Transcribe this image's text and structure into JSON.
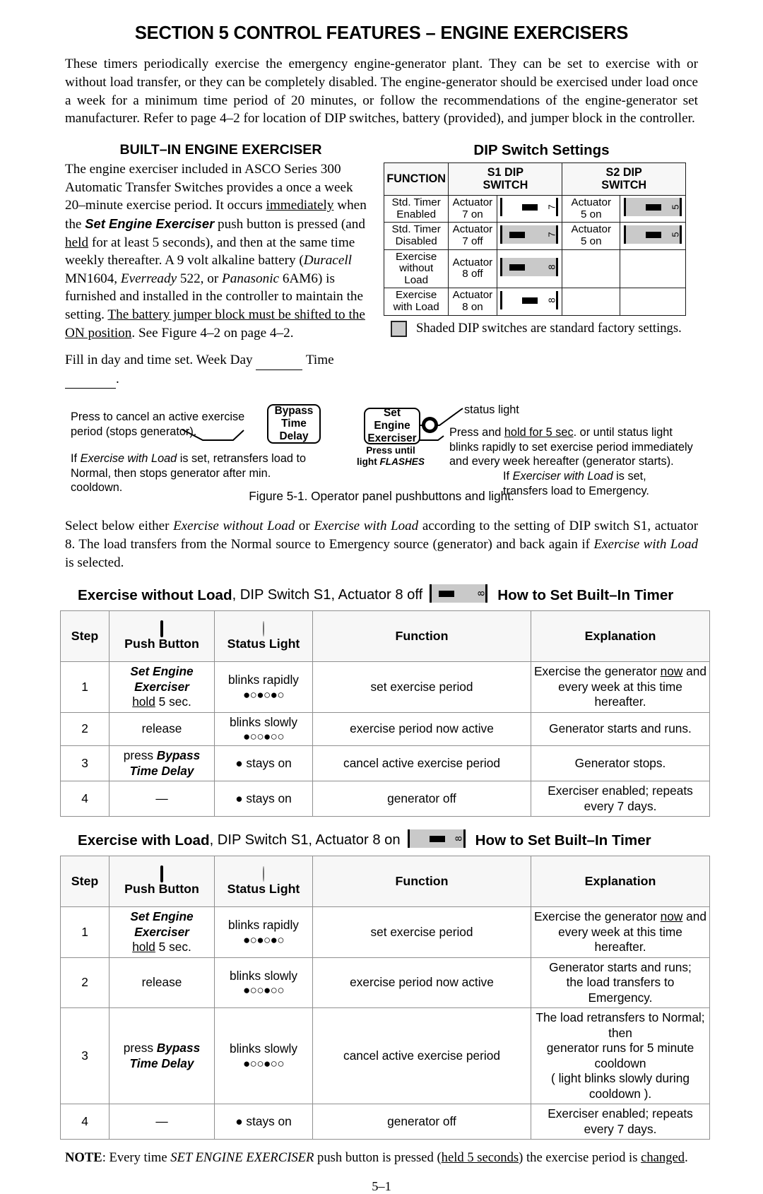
{
  "document": {
    "section_title": "SECTION 5  CONTROL FEATURES – ENGINE EXERCISERS",
    "intro": "These timers periodically exercise the emergency engine-generator plant.  They can be set to exercise with or without load transfer, or they can be completely disabled.  The engine-generator should be exercised under load once a week for a minimum time period of 20 minutes, or follow the recommendations of the engine-generator set manufacturer.  Refer to page 4–2 for location of DIP switches, battery (provided), and jumper block in the controller.",
    "page_number": "5–1",
    "note_label": "NOTE",
    "note_text_1": ": Every time ",
    "note_italic": "SET ENGINE EXERCISER",
    "note_text_2": " push button is pressed (",
    "note_underline": "held 5 seconds",
    "note_text_3": ") the exercise period is ",
    "note_underline_2": "changed",
    "note_text_4": "."
  },
  "built_in": {
    "heading": "BUILT–IN ENGINE EXERCISER",
    "para_1_a": "The engine exerciser included in ASCO Series 300 Automatic Transfer Switches provides a once a week 20–minute exercise period.  It occurs ",
    "para_1_u1": "immediately",
    "para_1_b": " when the ",
    "para_1_bi": "Set Engine Exerciser",
    "para_1_c": " push button is pressed (and ",
    "para_1_u2": "held",
    "para_1_d": " for at least 5 seconds), and then at the same time weekly thereafter.  A 9 volt alkaline battery (",
    "para_1_i1": "Duracell",
    "para_1_e": " MN1604, ",
    "para_1_i2": "Everready",
    "para_1_f": " 522, or ",
    "para_1_i3": "Panasonic",
    "para_1_g": " 6AM6) is furnished and installed in the controller to maintain the setting.  ",
    "para_1_u3": "The battery jumper block must be shifted to the ON position",
    "para_1_h": ".  See Figure 4–2 on page 4–2.",
    "fill_in_a": "Fill in day and time set.  Week Day ",
    "fill_in_b": " Time ",
    "fill_in_c": "."
  },
  "dip_table": {
    "title": "DIP Switch Settings",
    "headers": [
      "FUNCTION",
      "S1 DIP\nSWITCH",
      "S2 DIP\nSWITCH"
    ],
    "header_function": "FUNCTION",
    "header_s1_line1": "S1 DIP",
    "header_s1_line2": "SWITCH",
    "header_s2_line1": "S2 DIP",
    "header_s2_line2": "SWITCH",
    "rows": [
      {
        "function_line1": "Std. Timer",
        "function_line2": "Enabled",
        "s1_actuator_line1": "Actuator",
        "s1_actuator_line2": "7 on",
        "s1_switch": {
          "number": "7",
          "position": "right",
          "shaded": false
        },
        "s2_actuator_line1": "Actuator",
        "s2_actuator_line2": "5 on",
        "s2_switch": {
          "number": "5",
          "position": "right",
          "shaded": true
        }
      },
      {
        "function_line1": "Std. Timer",
        "function_line2": "Disabled",
        "s1_actuator_line1": "Actuator",
        "s1_actuator_line2": "7 off",
        "s1_switch": {
          "number": "7",
          "position": "left",
          "shaded": true
        },
        "s2_actuator_line1": "Actuator",
        "s2_actuator_line2": "5 on",
        "s2_switch": {
          "number": "5",
          "position": "right",
          "shaded": true
        }
      },
      {
        "function_line1": "Exercise",
        "function_line2": "without",
        "function_line3": "Load",
        "s1_actuator_line1": "Actuator",
        "s1_actuator_line2": "8 off",
        "s1_switch": {
          "number": "8",
          "position": "left",
          "shaded": true
        },
        "s2_actuator_line1": "",
        "s2_actuator_line2": "",
        "s2_switch": null
      },
      {
        "function_line1": "Exercise",
        "function_line2": "with Load",
        "s1_actuator_line1": "Actuator",
        "s1_actuator_line2": "8 on",
        "s1_switch": {
          "number": "8",
          "position": "right",
          "shaded": false
        },
        "s2_actuator_line1": "",
        "s2_actuator_line2": "",
        "s2_switch": null
      }
    ],
    "shaded_note": "Shaded DIP switches are standard factory settings."
  },
  "figure": {
    "caption": "Figure 5-1. Operator panel pushbuttons and light.",
    "bypass_button_line1": "Bypass",
    "bypass_button_line2": "Time Delay",
    "bypass_callout_line1": "Press to cancel an active exercise",
    "bypass_callout_line2": "period (stops generator).",
    "bypass_note_a": "If ",
    "bypass_note_i": "Exercise with Load",
    "bypass_note_b": " is set, retransfers load to",
    "bypass_note_line2": "Normal, then stops generator after min. cooldown.",
    "set_button_line1": "Set Engine",
    "set_button_line2": "Exerciser",
    "press_until_line1": "Press until",
    "press_until_line2_a": "light  ",
    "press_until_line2_i": "FLASHES",
    "status_light_label": "status light",
    "press_hold_a": "Press and ",
    "press_hold_u": "hold for 5 sec",
    "press_hold_b": ". or until status light",
    "press_hold_line2": "blinks rapidly to set exercise period immediately",
    "press_hold_line3": "and every week hereafter (generator starts).",
    "if_exerciser_a": "If ",
    "if_exerciser_i": "Exerciser with Load",
    "if_exerciser_b": " is set,",
    "if_exerciser_line2": "transfers load to Emergency."
  },
  "select_para": {
    "a": "Select below either ",
    "i1": "Exercise without Load",
    "b": " or ",
    "i2": "Exercise with Load",
    "c": " according to the setting of DIP switch S1, actuator 8. The load transfers from the Normal source to Emergency source (generator) and back again if ",
    "i3": "Exercise with Load",
    "d": " is selected."
  },
  "step_tables": [
    {
      "title_bold": "Exercise without Load",
      "title_rest": ", DIP Switch S1, Actuator 8 off",
      "title_icon": {
        "number": "8",
        "position": "left",
        "shaded": true
      },
      "title_right": "How to Set Built–In Timer",
      "headers": {
        "step": "Step",
        "push_button": "Push Button",
        "status_light": "Status Light",
        "function": "Function",
        "explanation": "Explanation"
      },
      "rows": [
        {
          "step": "1",
          "push_button_bi_1": "Set Engine",
          "push_button_bi_2": "Exerciser",
          "push_button_u": "hold",
          "push_button_rest": " 5 sec.",
          "light_label": "blinks rapidly",
          "light_pattern": "●○●○●○",
          "function": "set exercise period",
          "explanation_a": "Exercise the generator ",
          "explanation_u": "now",
          "explanation_b": " and",
          "explanation_line2": "every week at this time hereafter."
        },
        {
          "step": "2",
          "push_button": "release",
          "light_label": "blinks slowly",
          "light_pattern": "●○○●○○",
          "function": "exercise period now active",
          "explanation_line1": "Generator starts and runs."
        },
        {
          "step": "3",
          "push_button_pre": "press ",
          "push_button_bi_1": "Bypass",
          "push_button_bi_2": "Time Delay",
          "light_label": "● stays on",
          "function": "cancel active exercise period",
          "explanation_line1": "Generator stops."
        },
        {
          "step": "4",
          "push_button": "—",
          "light_label": "● stays on",
          "function": "generator off",
          "explanation_line1": "Exerciser enabled; repeats every 7 days."
        }
      ]
    },
    {
      "title_bold": "Exercise with Load",
      "title_rest": ", DIP Switch S1, Actuator 8 on",
      "title_icon": {
        "number": "8",
        "position": "right",
        "shaded": true
      },
      "title_right": "How to Set Built–In Timer",
      "headers": {
        "step": "Step",
        "push_button": "Push Button",
        "status_light": "Status Light",
        "function": "Function",
        "explanation": "Explanation"
      },
      "rows": [
        {
          "step": "1",
          "push_button_bi_1": "Set Engine",
          "push_button_bi_2": "Exerciser",
          "push_button_u": "hold",
          "push_button_rest": " 5 sec.",
          "light_label": "blinks rapidly",
          "light_pattern": "●○●○●○",
          "function": "set exercise period",
          "explanation_a": "Exercise the generator ",
          "explanation_u": "now",
          "explanation_b": " and",
          "explanation_line2": "every week at this time hereafter."
        },
        {
          "step": "2",
          "push_button": "release",
          "light_label": "blinks slowly",
          "light_pattern": "●○○●○○",
          "function": "exercise period now active",
          "explanation_line1": "Generator starts and runs;",
          "explanation_line2": "the load transfers to Emergency."
        },
        {
          "step": "3",
          "push_button_pre": "press ",
          "push_button_bi_1": "Bypass",
          "push_button_bi_2": "Time Delay",
          "light_label": "blinks slowly",
          "light_pattern": "●○○●○○",
          "function": "cancel active exercise period",
          "explanation_line1": "The load retransfers to Normal; then",
          "explanation_line2": "generator runs for 5 minute cooldown",
          "explanation_line3": "( light blinks slowly during cooldown )."
        },
        {
          "step": "4",
          "push_button": "—",
          "light_label": "● stays on",
          "function": "generator off",
          "explanation_line1": "Exerciser enabled; repeats every 7 days."
        }
      ]
    }
  ]
}
